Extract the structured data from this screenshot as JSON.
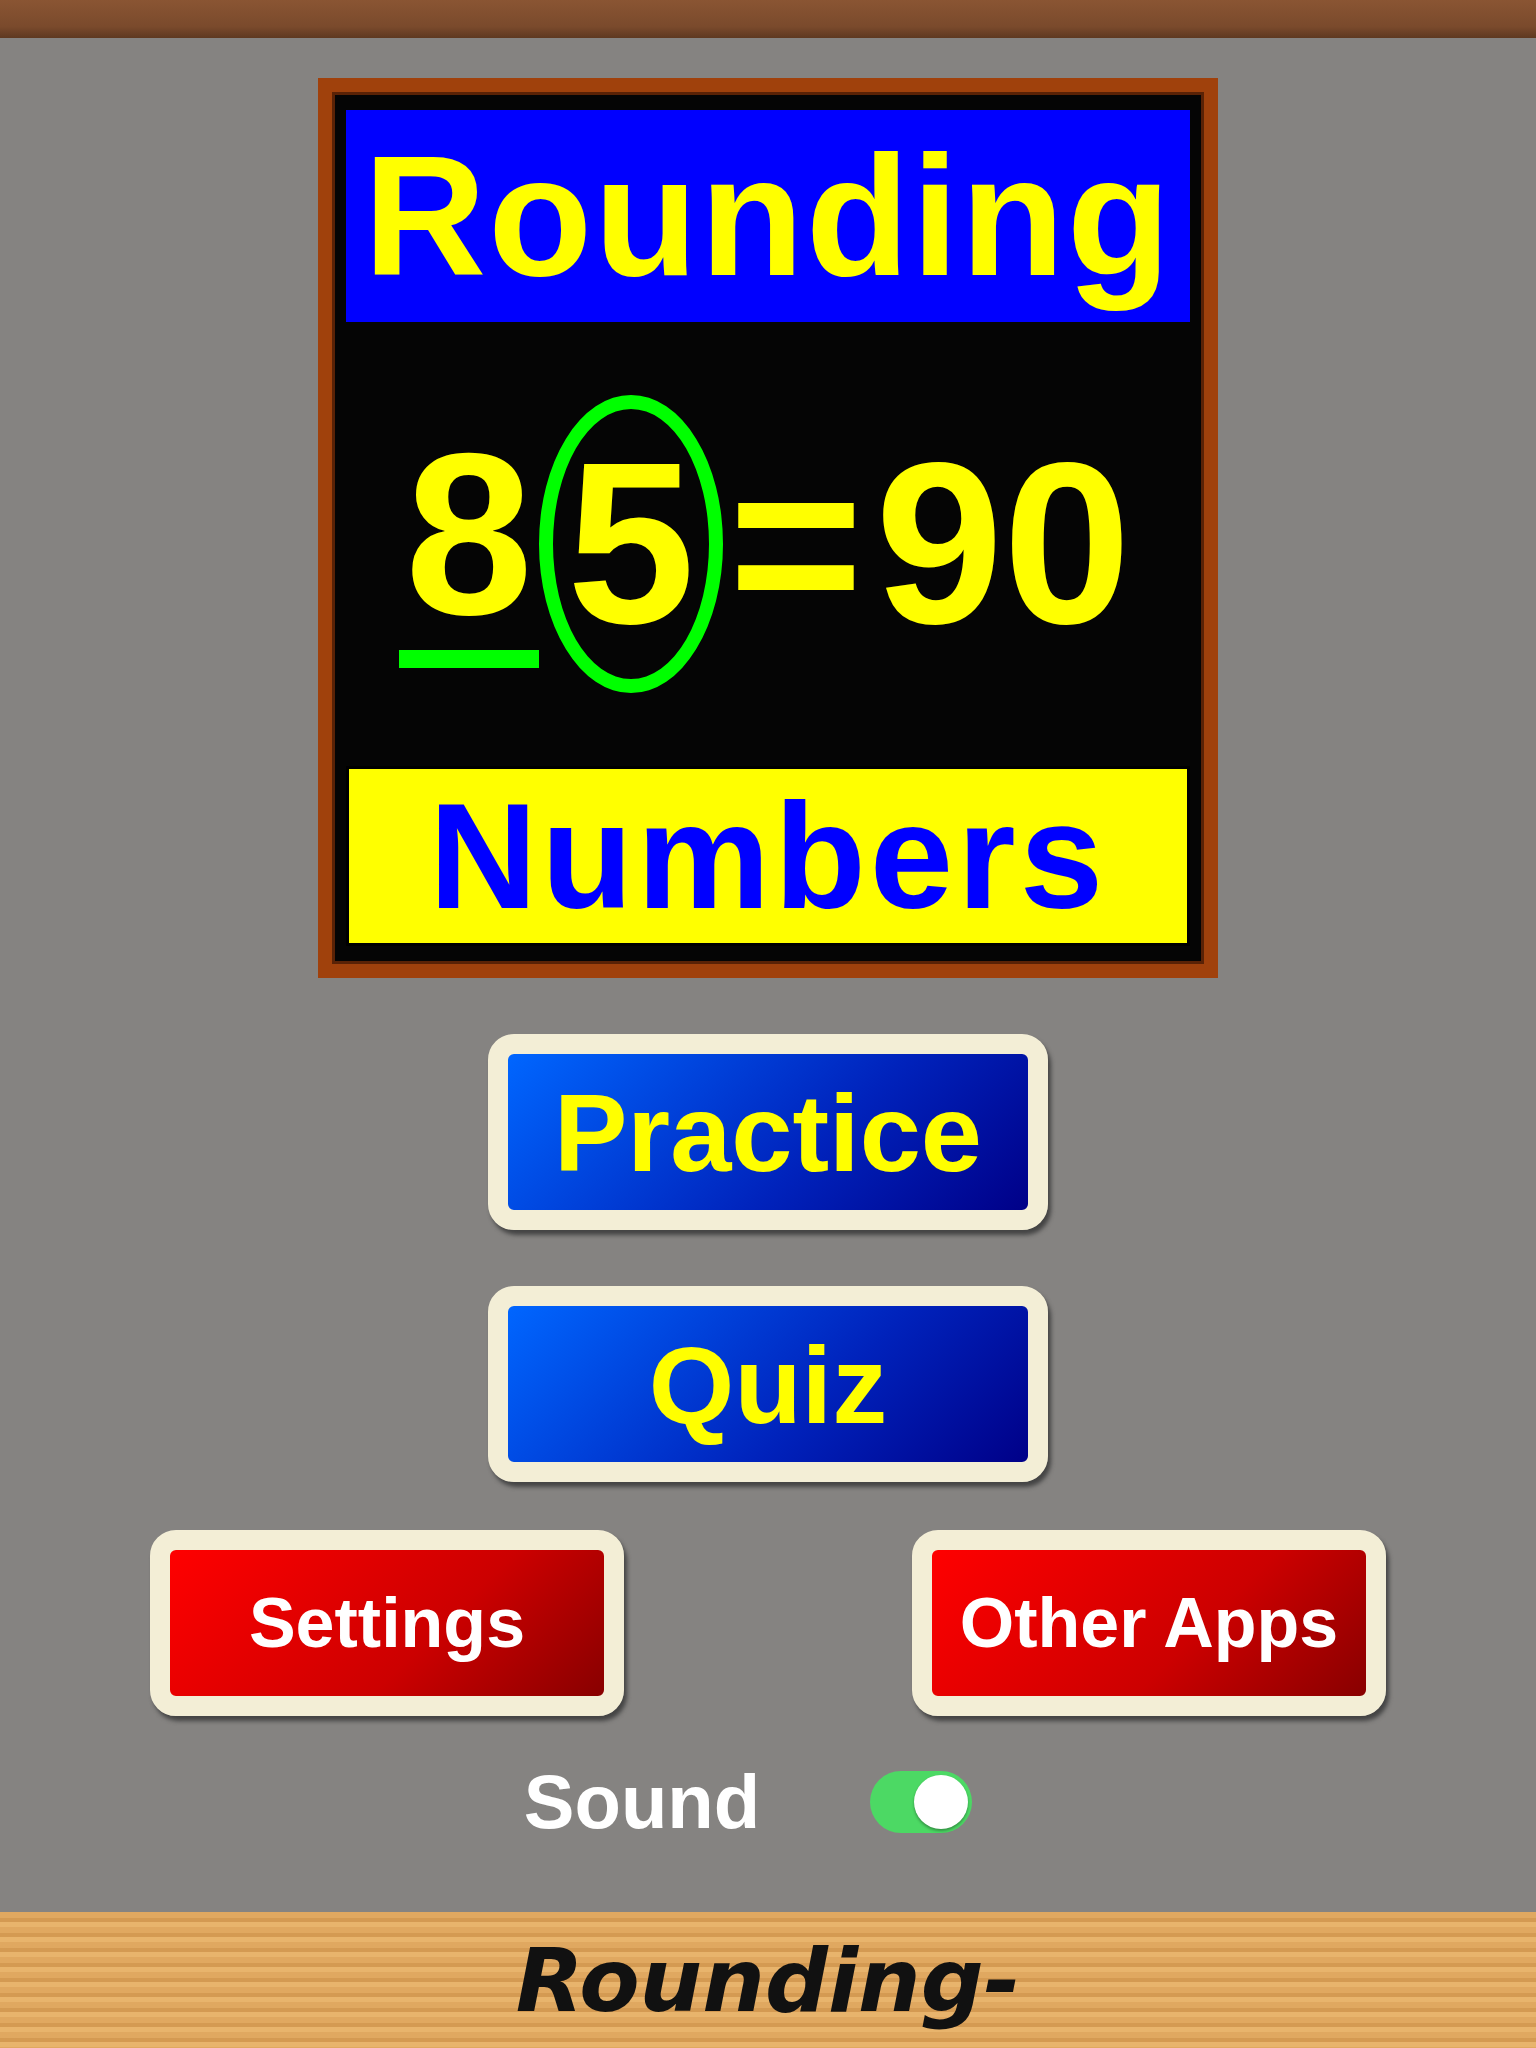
{
  "logo": {
    "title": "Rounding",
    "equation": [
      {
        "text": "8",
        "kind": "underlined"
      },
      {
        "text": "5",
        "kind": "circled"
      },
      {
        "text": "=",
        "kind": "plain"
      },
      {
        "text": "90",
        "kind": "plain"
      }
    ],
    "subtitle": "Numbers"
  },
  "main_buttons": [
    "Practice",
    "Quiz"
  ],
  "side_buttons": [
    "Settings",
    "Other Apps"
  ],
  "sound": {
    "label": "Sound",
    "on": true
  },
  "footer": {
    "title": "Rounding-"
  }
}
